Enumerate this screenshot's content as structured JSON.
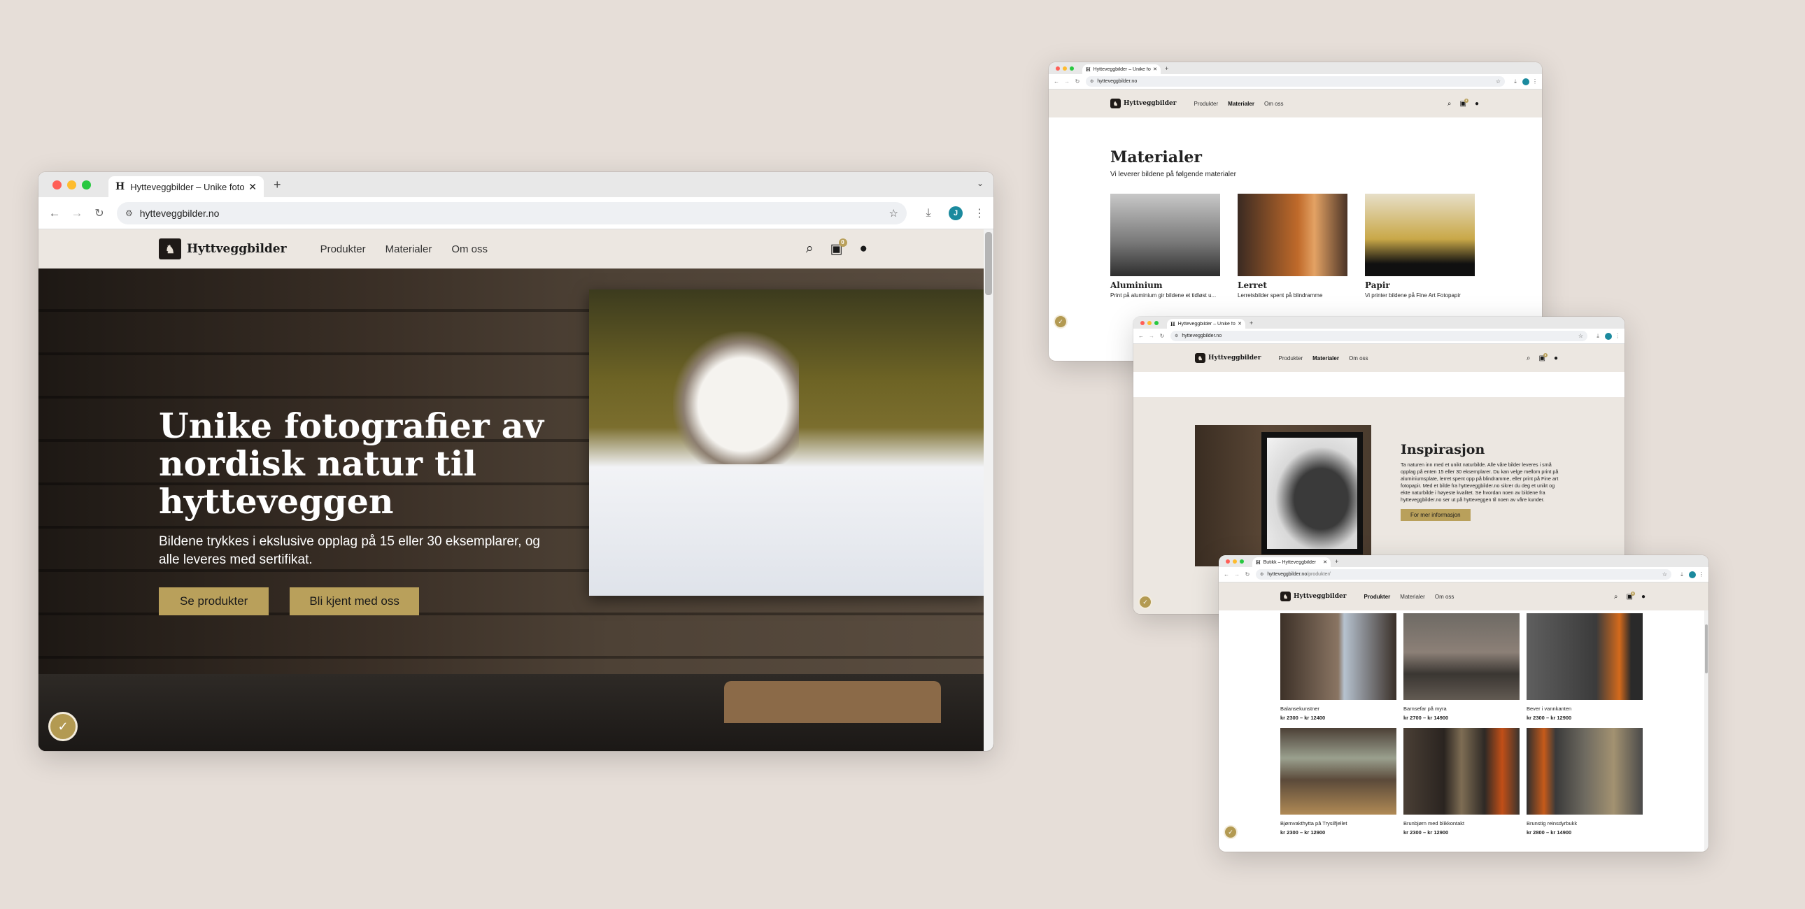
{
  "brand": {
    "name": "Hyttveggbilder",
    "accent": "#b9a05b",
    "header_bg": "#ece7e1",
    "page_bg": "#e6ded8"
  },
  "nav": {
    "products": "Produkter",
    "materials": "Materialer",
    "about": "Om oss"
  },
  "icons": [
    "search-icon",
    "cart-icon",
    "user-icon",
    "back-icon",
    "forward-icon",
    "reload-icon",
    "star-icon",
    "download-icon",
    "menu-icon",
    "cookie-icon"
  ],
  "main_window": {
    "tab_title": "Hytteveggbilder – Unike foto",
    "url": "hytteveggbilder.no",
    "avatar": "J",
    "cart_count": "0",
    "hero": {
      "heading": "Unike fotografier av nordisk natur til hytteveggen",
      "subheading": "Bildene trykkes i ekslusive opplag på 15 eller 30 eksemplarer, og alle leveres med sertifikat.",
      "btn_products": "Se produkter",
      "btn_about": "Bli kjent med oss"
    }
  },
  "materials_window": {
    "tab_title": "Hytteveggbilder – Unike foto",
    "url": "hytteveggbilder.no",
    "title": "Materialer",
    "subtitle": "Vi leverer bildene på følgende materialer",
    "items": [
      {
        "name": "Aluminium",
        "desc": "Print på aluminium gir bildene et tidløst u..."
      },
      {
        "name": "Lerret",
        "desc": "Lerretsbilder spent på blindramme"
      },
      {
        "name": "Papir",
        "desc": "Vi printer bildene på Fine Art Fotopapir"
      }
    ]
  },
  "inspiration_window": {
    "tab_title": "Hytteveggbilder – Unike foto",
    "url": "hytteveggbilder.no",
    "title": "Inspirasjon",
    "body": "Ta naturen inn med et unikt naturbilde. Alle våre bilder leveres i små opplag på enten 15 eller 30 eksemplarer. Du kan velge mellom print på aluminiumsplate, lerret spent opp på blindramme, eller print på Fine art fotopapir. Med et bilde fra hytteveggbilder.no sikrer du deg et unikt og ekte naturbilde i høyeste kvalitet. Se hvordan noen av bildene fra hytteveggbilder.no ser ut på hytteveggen til noen av våre kunder.",
    "button": "For mer informasjon"
  },
  "products_window": {
    "tab_title": "Butikk – Hytteveggbilder",
    "url": "hytteveggbilder.no",
    "url_path": "/produkter/",
    "products": [
      {
        "name": "Balansekunstner",
        "price": "kr 2300 – kr 12400"
      },
      {
        "name": "Barnsefar på myra",
        "price": "kr 2700 – kr 14900"
      },
      {
        "name": "Bever i vannkanten",
        "price": "kr 2300 – kr 12900"
      },
      {
        "name": "Bjørnvakthytta på Trysilfjellet",
        "price": "kr 2300 – kr 12900"
      },
      {
        "name": "Brunbjørn med blikkontakt",
        "price": "kr 2300 – kr 12900"
      },
      {
        "name": "Brunstig reinsdyrbukk",
        "price": "kr 2800 – kr 14900"
      }
    ]
  }
}
